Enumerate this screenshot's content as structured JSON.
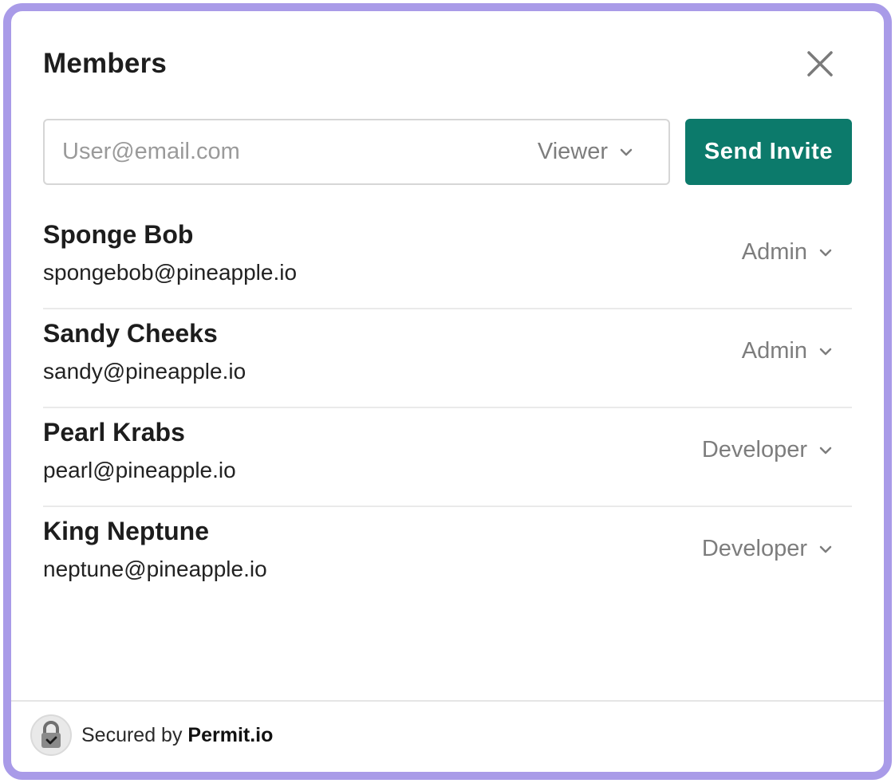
{
  "dialog": {
    "title": "Members"
  },
  "invite": {
    "email_placeholder": "User@email.com",
    "email_value": "",
    "role": "Viewer",
    "send_label": "Send Invite"
  },
  "members": [
    {
      "name": "Sponge Bob",
      "email": "spongebob@pineapple.io",
      "role": "Admin"
    },
    {
      "name": "Sandy Cheeks",
      "email": "sandy@pineapple.io",
      "role": "Admin"
    },
    {
      "name": "Pearl Krabs",
      "email": "pearl@pineapple.io",
      "role": "Developer"
    },
    {
      "name": "King Neptune",
      "email": "neptune@pineapple.io",
      "role": "Developer"
    }
  ],
  "footer": {
    "secured_prefix": "Secured by",
    "secured_brand": "Permit.io"
  },
  "icons": {
    "close": "close-icon",
    "chevron": "chevron-down-icon",
    "lock": "lock-icon"
  },
  "colors": {
    "frame_border": "#a99be8",
    "primary_button": "#0c7a6b",
    "muted_text": "#7d7d7d"
  }
}
